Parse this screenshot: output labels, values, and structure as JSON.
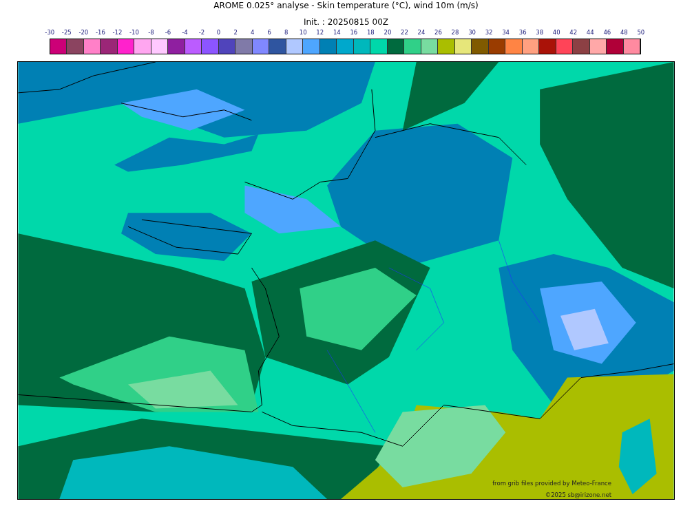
{
  "title": "AROME 0.025° analyse - Skin temperature (°C), wind 10m (m/s)",
  "subtitle": "Init. : 20250815 00Z",
  "colorbar": {
    "labels": [
      "-30",
      "-25",
      "-20",
      "-16",
      "-12",
      "-10",
      "-8",
      "-6",
      "-4",
      "-2",
      "0",
      "2",
      "4",
      "6",
      "8",
      "10",
      "12",
      "14",
      "16",
      "18",
      "20",
      "22",
      "24",
      "26",
      "28",
      "30",
      "32",
      "34",
      "36",
      "38",
      "40",
      "42",
      "44",
      "46",
      "48",
      "50"
    ],
    "bins": [
      {
        "color": "#cc0077"
      },
      {
        "color": "#8b4460"
      },
      {
        "color": "#ff80c8"
      },
      {
        "color": "#9b2677"
      },
      {
        "color": "#ff22cc"
      },
      {
        "color": "#ffa6f0"
      },
      {
        "color": "#ffc8ff"
      },
      {
        "color": "#8f1fa0"
      },
      {
        "color": "#bb5cff"
      },
      {
        "color": "#8c55ff"
      },
      {
        "color": "#5044bb"
      },
      {
        "color": "#807aa8"
      },
      {
        "color": "#8088ff"
      },
      {
        "color": "#2f55a0"
      },
      {
        "color": "#b0c8ff"
      },
      {
        "color": "#4ea6ff"
      },
      {
        "color": "#0080b4"
      },
      {
        "color": "#00a8cc"
      },
      {
        "color": "#00b8bc"
      },
      {
        "color": "#00d8aa"
      },
      {
        "color": "#006a3e"
      },
      {
        "color": "#30d088"
      },
      {
        "color": "#78dca0"
      },
      {
        "color": "#aabe00"
      },
      {
        "color": "#e6e67a"
      },
      {
        "color": "#805a00"
      },
      {
        "color": "#9a3c00"
      },
      {
        "color": "#ff8444"
      },
      {
        "color": "#ffa080"
      },
      {
        "color": "#aa1208"
      },
      {
        "color": "#ff4458"
      },
      {
        "color": "#8c4044"
      },
      {
        "color": "#ffa8a8"
      },
      {
        "color": "#b00038"
      },
      {
        "color": "#ff8aa0"
      }
    ]
  },
  "map": {
    "credits": [
      "from grib files provided by Meteo-France",
      "©2025 sb@irizone.net"
    ]
  }
}
